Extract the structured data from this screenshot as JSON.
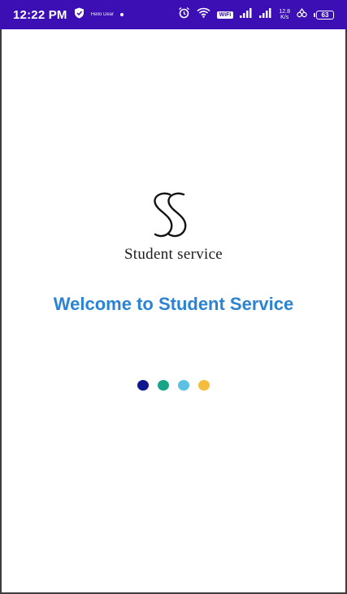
{
  "status_bar": {
    "time": "12:22 PM",
    "tiny_label": "Hello Dear",
    "wifi_label": "WiFi",
    "network_speed_value": "12.8",
    "network_speed_unit": "K/s",
    "battery_level": "63",
    "background_color": "#3c0fb4"
  },
  "app": {
    "logo_text": "Student service",
    "welcome_text": "Welcome to Student Service",
    "welcome_color": "#2a83d3"
  },
  "loader": {
    "dots": [
      {
        "name": "loading-dot-1",
        "color": "#0e1690"
      },
      {
        "name": "loading-dot-2",
        "color": "#17a586"
      },
      {
        "name": "loading-dot-3",
        "color": "#5cc0e2"
      },
      {
        "name": "loading-dot-4",
        "color": "#f4be3c"
      }
    ]
  }
}
